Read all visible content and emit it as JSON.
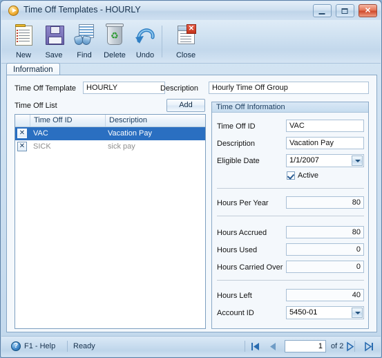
{
  "window": {
    "title": "Time Off Templates - HOURLY",
    "icon": "app-play-circle-icon",
    "buttons": {
      "minimize": "–",
      "maximize": "□",
      "close": "✕"
    }
  },
  "toolbar": {
    "items": [
      {
        "label": "New",
        "icon": "new-document-icon"
      },
      {
        "label": "Save",
        "icon": "floppy-disk-icon"
      },
      {
        "label": "Find",
        "icon": "binoculars-icon"
      },
      {
        "label": "Delete",
        "icon": "recycle-bin-icon"
      },
      {
        "label": "Undo",
        "icon": "undo-arrow-icon"
      },
      {
        "label": "Close",
        "icon": "close-document-icon"
      }
    ]
  },
  "tabs": [
    {
      "label": "Information",
      "selected": true
    }
  ],
  "header_form": {
    "template_label": "Time Off Template",
    "template_value": "HOURLY",
    "description_label": "Description",
    "description_value": "Hourly Time Off Group"
  },
  "list_section": {
    "title": "Time Off List",
    "add_label": "Add",
    "columns": [
      "",
      "Time Off ID",
      "Description"
    ],
    "rows": [
      {
        "action": "✕",
        "id": "VAC",
        "description": "Vacation Pay",
        "selected": true
      },
      {
        "action": "✕",
        "id": "SICK",
        "description": "sick pay",
        "selected": false
      }
    ]
  },
  "info_group": {
    "title": "Time Off Information",
    "fields": {
      "time_off_id_label": "Time Off ID",
      "time_off_id_value": "VAC",
      "description_label": "Description",
      "description_value": "Vacation Pay",
      "eligible_date_label": "Eligible Date",
      "eligible_date_value": "1/1/2007",
      "active_label": "Active",
      "active_checked": true,
      "hours_per_year_label": "Hours Per Year",
      "hours_per_year_value": "80",
      "hours_accrued_label": "Hours Accrued",
      "hours_accrued_value": "80",
      "hours_used_label": "Hours Used",
      "hours_used_value": "0",
      "hours_carried_over_label": "Hours Carried Over",
      "hours_carried_over_value": "0",
      "hours_left_label": "Hours Left",
      "hours_left_value": "40",
      "account_id_label": "Account ID",
      "account_id_value": "5450-01"
    }
  },
  "statusbar": {
    "help_label": "F1 - Help",
    "state_label": "Ready",
    "nav": {
      "first": "first-record-icon",
      "prev": "previous-record-icon",
      "current": "1",
      "of_label": "of  2",
      "next": "next-record-icon",
      "last": "last-record-icon"
    }
  },
  "colors": {
    "selection": "#2a6fc1",
    "titlebar": "#cfe0f0",
    "panel_bg": "#f4f8fc",
    "border": "#87a7c6"
  }
}
